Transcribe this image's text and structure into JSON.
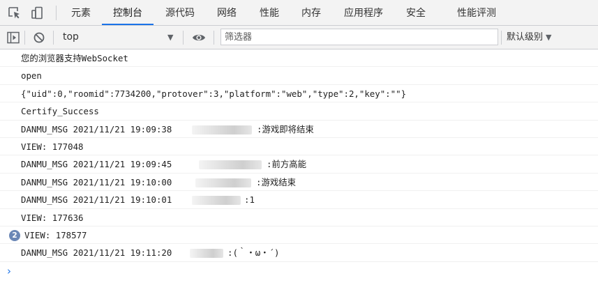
{
  "tabs": [
    "元素",
    "控制台",
    "源代码",
    "网络",
    "性能",
    "内存",
    "应用程序",
    "安全",
    "性能评测"
  ],
  "active_tab": "控制台",
  "toolbar": {
    "context": "top",
    "filter_placeholder": "筛选器",
    "levels_label": "默认级别"
  },
  "console": {
    "lines": [
      {
        "text": "您的浏览器支持WebSocket"
      },
      {
        "text": "open"
      },
      {
        "text": "{\"uid\":0,\"roomid\":7734200,\"protover\":3,\"platform\":\"web\",\"type\":2,\"key\":\"\"}"
      },
      {
        "text": "Certify_Success"
      },
      {
        "text": "DANMU_MSG 2021/11/21 19:09:38",
        "after": ":游戏即将结束"
      },
      {
        "text": "VIEW: 177048"
      },
      {
        "text": "DANMU_MSG 2021/11/21 19:09:45",
        "after": ":前方高能"
      },
      {
        "text": "DANMU_MSG 2021/11/21 19:10:00",
        "after": ":游戏结束"
      },
      {
        "text": "DANMU_MSG 2021/11/21 19:10:01",
        "after": ":1"
      },
      {
        "text": "VIEW: 177636"
      },
      {
        "text": "VIEW: 178577",
        "repeat_count": "2"
      },
      {
        "text": "DANMU_MSG 2021/11/21 19:11:20",
        "after": ":(｀・ω・´)"
      }
    ]
  },
  "colors": {
    "accent": "#1a73e8",
    "toolbar_bg": "#f3f3f3",
    "badge": "#6b87b6"
  },
  "icons": [
    "inspect-element-icon",
    "device-toolbar-icon",
    "sidebar-toggle-icon",
    "clear-console-icon",
    "live-expression-eye-icon",
    "prompt-chevron-icon"
  ]
}
